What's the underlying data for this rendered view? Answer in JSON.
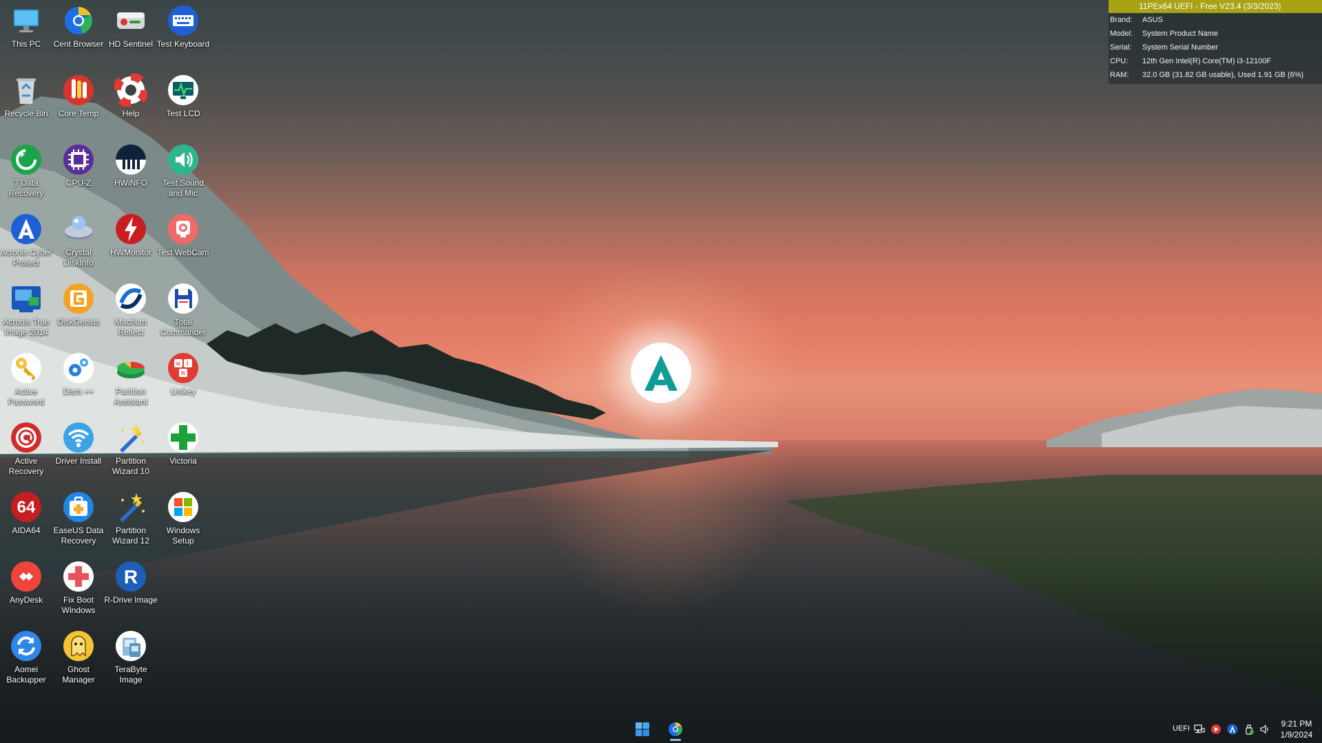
{
  "desktop": {
    "icons": [
      {
        "label": "This PC",
        "icon": "monitor-icon"
      },
      {
        "label": "Cent Browser",
        "icon": "cent-browser-icon"
      },
      {
        "label": "HD Sentinel",
        "icon": "hd-sentinel-icon"
      },
      {
        "label": "Test Keyboard",
        "icon": "keyboard-icon"
      },
      {
        "label": "Recycle Bin",
        "icon": "recycle-bin-icon"
      },
      {
        "label": "Core Temp",
        "icon": "thermometer-icon"
      },
      {
        "label": "Help",
        "icon": "lifebuoy-icon"
      },
      {
        "label": "Test LCD",
        "icon": "lcd-test-icon"
      },
      {
        "label": "7 Data Recovery",
        "icon": "data-recovery-icon"
      },
      {
        "label": "CPU-Z",
        "icon": "cpu-chip-icon"
      },
      {
        "label": "HWiNFO",
        "icon": "hwinfo-icon"
      },
      {
        "label": "Test Sound and Mic",
        "icon": "speaker-icon"
      },
      {
        "label": "Acronis Cyber Protect",
        "icon": "acronis-icon"
      },
      {
        "label": "Crystal DiskInfo",
        "icon": "crystal-disk-icon"
      },
      {
        "label": "HWMonitor",
        "icon": "lightning-icon"
      },
      {
        "label": "Test WebCam",
        "icon": "webcam-icon"
      },
      {
        "label": "Acronis True Image 2014",
        "icon": "true-image-icon"
      },
      {
        "label": "DiskGenius",
        "icon": "diskgenius-icon"
      },
      {
        "label": "Macrium Reflect",
        "icon": "macrium-icon"
      },
      {
        "label": "Total Commander",
        "icon": "floppy-disk-icon"
      },
      {
        "label": "Active Password",
        "icon": "key-icon"
      },
      {
        "label": "Dism ++",
        "icon": "gears-icon"
      },
      {
        "label": "Partition Assistant",
        "icon": "partition-assistant-icon"
      },
      {
        "label": "Unikey",
        "icon": "unikey-icon"
      },
      {
        "label": "Active Recovery",
        "icon": "at-sign-icon"
      },
      {
        "label": "Driver Install",
        "icon": "wifi-icon"
      },
      {
        "label": "Partition Wizard 10",
        "icon": "magic-wand-icon"
      },
      {
        "label": "Victoria",
        "icon": "green-cross-icon"
      },
      {
        "label": "AIDA64",
        "icon": "aida64-icon"
      },
      {
        "label": "EaseUS Data Recovery",
        "icon": "first-aid-kit-icon"
      },
      {
        "label": "Partition Wizard 12",
        "icon": "magic-wand-icon"
      },
      {
        "label": "Windows Setup",
        "icon": "windows-logo-icon"
      },
      {
        "label": "AnyDesk",
        "icon": "anydesk-icon"
      },
      {
        "label": "Fix Boot Windows",
        "icon": "red-cross-icon"
      },
      {
        "label": "R-Drive Image",
        "icon": "r-drive-icon"
      },
      {
        "label": "Aomei Backupper",
        "icon": "sync-arrows-icon"
      },
      {
        "label": "Ghost Manager",
        "icon": "ghost-icon"
      },
      {
        "label": "TeraByte Image",
        "icon": "terabyte-icon"
      }
    ]
  },
  "info_panel": {
    "title": "11PEx64 UEFI - Free V23.4 (3/3/2023)",
    "rows": [
      {
        "key": "Brand:",
        "value": "ASUS"
      },
      {
        "key": "Model:",
        "value": "System Product Name"
      },
      {
        "key": "Serial:",
        "value": "System Serial Number"
      },
      {
        "key": "CPU:",
        "value": "12th Gen Intel(R) Core(TM) i3-12100F"
      },
      {
        "key": "RAM:",
        "value": "32.0 GB (31.82 GB usable), Used 1.91 GB (6%)"
      }
    ],
    "title_bg": "#a8a214"
  },
  "taskbar": {
    "start_icon": "windows-start-icon",
    "pinned": [
      {
        "icon": "cent-browser-icon",
        "active": true
      }
    ],
    "tray": {
      "label": "UEFI",
      "icons": [
        "network-icon",
        "media-player-icon",
        "acronis-tray-icon",
        "usb-eject-icon",
        "volume-icon"
      ],
      "time": "9:21 PM",
      "date": "1/9/2024"
    }
  },
  "wallpaper": {
    "logo": "acronis-a-logo",
    "accent": "#0e9c96"
  }
}
